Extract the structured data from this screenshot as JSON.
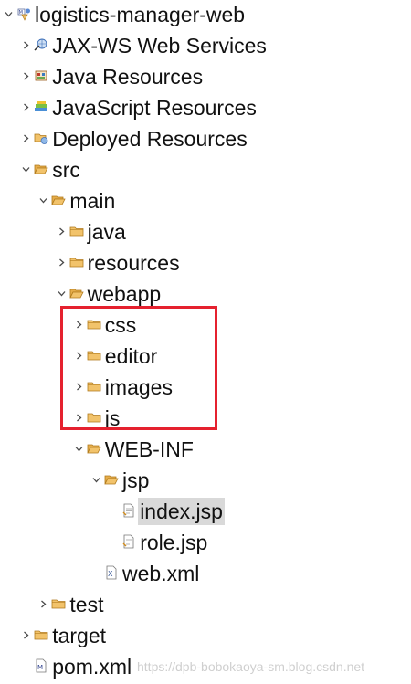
{
  "colors": {
    "highlight_border": "#e5212f",
    "selection_background": "#d9d9d9",
    "folder_fill": "#f2c36b",
    "watermark_text": "#cfcfcf"
  },
  "tree": {
    "nodes": [
      {
        "name": "tree-node-logistics-manager-web",
        "label": "logistics-manager-web",
        "icon": "maven-project-icon",
        "expanded": true,
        "depth": 0
      },
      {
        "name": "tree-node-jax-ws-web-services",
        "label": "JAX-WS Web Services",
        "icon": "web-services-icon",
        "expanded": false,
        "depth": 1
      },
      {
        "name": "tree-node-java-resources",
        "label": "Java Resources",
        "icon": "java-resources-icon",
        "expanded": false,
        "depth": 1
      },
      {
        "name": "tree-node-javascript-resources",
        "label": "JavaScript Resources",
        "icon": "javascript-resources-icon",
        "expanded": false,
        "depth": 1
      },
      {
        "name": "tree-node-deployed-resources",
        "label": "Deployed Resources",
        "icon": "deployed-resources-icon",
        "expanded": false,
        "depth": 1
      },
      {
        "name": "tree-node-src",
        "label": "src",
        "icon": "folder-open-icon",
        "expanded": true,
        "depth": 1
      },
      {
        "name": "tree-node-main",
        "label": "main",
        "icon": "folder-open-icon",
        "expanded": true,
        "depth": 2
      },
      {
        "name": "tree-node-java",
        "label": "java",
        "icon": "folder-icon",
        "expanded": false,
        "depth": 3
      },
      {
        "name": "tree-node-resources",
        "label": "resources",
        "icon": "folder-icon",
        "expanded": false,
        "depth": 3
      },
      {
        "name": "tree-node-webapp",
        "label": "webapp",
        "icon": "folder-open-icon",
        "expanded": true,
        "depth": 3
      },
      {
        "name": "tree-node-css",
        "label": "css",
        "icon": "folder-icon",
        "expanded": false,
        "depth": 4
      },
      {
        "name": "tree-node-editor",
        "label": "editor",
        "icon": "folder-icon",
        "expanded": false,
        "depth": 4
      },
      {
        "name": "tree-node-images",
        "label": "images",
        "icon": "folder-icon",
        "expanded": false,
        "depth": 4
      },
      {
        "name": "tree-node-js",
        "label": "js",
        "icon": "folder-icon",
        "expanded": false,
        "depth": 4
      },
      {
        "name": "tree-node-web-inf",
        "label": "WEB-INF",
        "icon": "folder-open-icon",
        "expanded": true,
        "depth": 4
      },
      {
        "name": "tree-node-jsp",
        "label": "jsp",
        "icon": "folder-open-icon",
        "expanded": true,
        "depth": 5
      },
      {
        "name": "tree-node-index-jsp",
        "label": "index.jsp",
        "icon": "jsp-file-icon",
        "expanded": null,
        "depth": 6,
        "selected": true
      },
      {
        "name": "tree-node-role-jsp",
        "label": "role.jsp",
        "icon": "jsp-file-icon",
        "expanded": null,
        "depth": 6
      },
      {
        "name": "tree-node-web-xml",
        "label": "web.xml",
        "icon": "xml-file-icon",
        "expanded": null,
        "depth": 5
      },
      {
        "name": "tree-node-test",
        "label": "test",
        "icon": "folder-icon",
        "expanded": false,
        "depth": 2
      },
      {
        "name": "tree-node-target",
        "label": "target",
        "icon": "folder-icon",
        "expanded": false,
        "depth": 1
      },
      {
        "name": "tree-node-pom-xml",
        "label": "pom.xml",
        "icon": "maven-pom-file-icon",
        "expanded": null,
        "depth": 1
      }
    ]
  },
  "watermark": {
    "text": "https://dpb-bobokaoya-sm.blog.csdn.net"
  }
}
